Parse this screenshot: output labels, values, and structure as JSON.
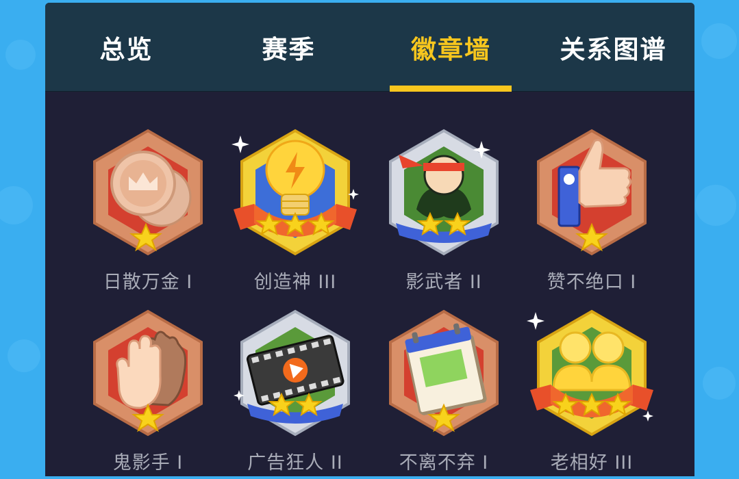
{
  "tabs": [
    {
      "label": "总览",
      "active": false
    },
    {
      "label": "赛季",
      "active": false
    },
    {
      "label": "徽章墙",
      "active": true
    },
    {
      "label": "关系图谱",
      "active": false
    }
  ],
  "badges": [
    {
      "name": "日散万金 I",
      "tier": "bronze",
      "stars": 1,
      "icon": "coin-crown-icon"
    },
    {
      "name": "创造神 III",
      "tier": "gold",
      "stars": 3,
      "icon": "lightbulb-icon"
    },
    {
      "name": "影武者 II",
      "tier": "silver",
      "stars": 2,
      "icon": "ninja-icon"
    },
    {
      "name": "赞不绝口 I",
      "tier": "bronze",
      "stars": 1,
      "icon": "thumbs-up-icon"
    },
    {
      "name": "鬼影手 I",
      "tier": "bronze",
      "stars": 1,
      "icon": "hand-icon"
    },
    {
      "name": "广告狂人 II",
      "tier": "silver",
      "stars": 2,
      "icon": "film-play-icon"
    },
    {
      "name": "不离不弃 I",
      "tier": "bronze",
      "stars": 1,
      "icon": "calendar-icon"
    },
    {
      "name": "老相好 III",
      "tier": "gold",
      "stars": 3,
      "icon": "couple-icon"
    }
  ],
  "colors": {
    "accent": "#f7c61e",
    "panel": "#1f1f36",
    "tabbar": "#1c3748",
    "background": "#3aaef0",
    "label": "#a9acb8"
  }
}
